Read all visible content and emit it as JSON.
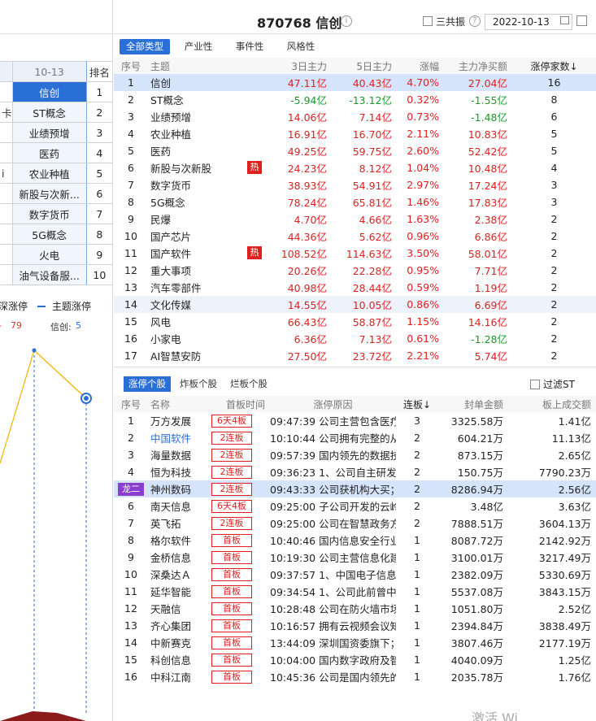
{
  "left": {
    "date_header": "10-13",
    "rank_header": "排名",
    "rows": [
      {
        "topic": "信创",
        "rank": "1",
        "cut": ""
      },
      {
        "topic": "ST概念",
        "rank": "2",
        "cut": "卡"
      },
      {
        "topic": "业绩预增",
        "rank": "3",
        "cut": ""
      },
      {
        "topic": "医药",
        "rank": "4",
        "cut": ""
      },
      {
        "topic": "农业种植",
        "rank": "5",
        "cut": "i"
      },
      {
        "topic": "新股与次新...",
        "rank": "6",
        "cut": ""
      },
      {
        "topic": "数字货币",
        "rank": "7",
        "cut": ""
      },
      {
        "topic": "5G概念",
        "rank": "8",
        "cut": ""
      },
      {
        "topic": "火电",
        "rank": "9",
        "cut": ""
      },
      {
        "topic": "油气设备服...",
        "rank": "10",
        "cut": ""
      }
    ],
    "legend_left": "深涨停",
    "legend_right": "主题涨停",
    "value_a": "-",
    "value_b": "79",
    "label_c": "信创:",
    "value_c": "5"
  },
  "header": {
    "code_title": "870768 信创",
    "checkbox_label": "三共振",
    "date": "2022-10-13"
  },
  "tabs": [
    "全部类型",
    "产业性",
    "事件性",
    "风格性"
  ],
  "topic_table": {
    "columns": [
      "序号",
      "主题",
      "3日主力",
      "5日主力",
      "涨幅",
      "主力净买额",
      "涨停家数↓"
    ],
    "rows": [
      {
        "n": "1",
        "name": "信创",
        "hot": "",
        "d3": "47.11亿",
        "d5": "40.43亿",
        "chg": "4.70%",
        "net": "27.04亿",
        "cnt": "16",
        "c3": "red",
        "c5": "red",
        "cc": "red",
        "cn": "red"
      },
      {
        "n": "2",
        "name": "ST概念",
        "hot": "",
        "d3": "-5.94亿",
        "d5": "-13.12亿",
        "chg": "0.32%",
        "net": "-1.55亿",
        "cnt": "8",
        "c3": "green",
        "c5": "green",
        "cc": "red",
        "cn": "green"
      },
      {
        "n": "3",
        "name": "业绩预增",
        "hot": "",
        "d3": "14.06亿",
        "d5": "7.14亿",
        "chg": "0.73%",
        "net": "-1.48亿",
        "cnt": "6",
        "c3": "red",
        "c5": "red",
        "cc": "red",
        "cn": "green"
      },
      {
        "n": "4",
        "name": "农业种植",
        "hot": "",
        "d3": "16.91亿",
        "d5": "16.70亿",
        "chg": "2.11%",
        "net": "10.83亿",
        "cnt": "5",
        "c3": "red",
        "c5": "red",
        "cc": "red",
        "cn": "red"
      },
      {
        "n": "5",
        "name": "医药",
        "hot": "",
        "d3": "49.25亿",
        "d5": "59.75亿",
        "chg": "2.60%",
        "net": "52.42亿",
        "cnt": "5",
        "c3": "red",
        "c5": "red",
        "cc": "red",
        "cn": "red"
      },
      {
        "n": "6",
        "name": "新股与次新股",
        "hot": "热",
        "d3": "24.23亿",
        "d5": "8.12亿",
        "chg": "1.04%",
        "net": "10.48亿",
        "cnt": "4",
        "c3": "red",
        "c5": "red",
        "cc": "red",
        "cn": "red"
      },
      {
        "n": "7",
        "name": "数字货币",
        "hot": "",
        "d3": "38.93亿",
        "d5": "54.91亿",
        "chg": "2.97%",
        "net": "17.24亿",
        "cnt": "3",
        "c3": "red",
        "c5": "red",
        "cc": "red",
        "cn": "red"
      },
      {
        "n": "8",
        "name": "5G概念",
        "hot": "",
        "d3": "78.24亿",
        "d5": "65.81亿",
        "chg": "1.46%",
        "net": "17.83亿",
        "cnt": "3",
        "c3": "red",
        "c5": "red",
        "cc": "red",
        "cn": "red"
      },
      {
        "n": "9",
        "name": "民爆",
        "hot": "",
        "d3": "4.70亿",
        "d5": "4.66亿",
        "chg": "1.63%",
        "net": "2.38亿",
        "cnt": "2",
        "c3": "red",
        "c5": "red",
        "cc": "red",
        "cn": "red"
      },
      {
        "n": "10",
        "name": "国产芯片",
        "hot": "",
        "d3": "44.36亿",
        "d5": "5.62亿",
        "chg": "0.96%",
        "net": "6.86亿",
        "cnt": "2",
        "c3": "red",
        "c5": "red",
        "cc": "red",
        "cn": "red"
      },
      {
        "n": "11",
        "name": "国产软件",
        "hot": "热",
        "d3": "108.52亿",
        "d5": "114.63亿",
        "chg": "3.50%",
        "net": "58.01亿",
        "cnt": "2",
        "c3": "red",
        "c5": "red",
        "cc": "red",
        "cn": "red"
      },
      {
        "n": "12",
        "name": "重大事项",
        "hot": "",
        "d3": "20.26亿",
        "d5": "22.28亿",
        "chg": "0.95%",
        "net": "7.71亿",
        "cnt": "2",
        "c3": "red",
        "c5": "red",
        "cc": "red",
        "cn": "red"
      },
      {
        "n": "13",
        "name": "汽车零部件",
        "hot": "",
        "d3": "40.98亿",
        "d5": "28.44亿",
        "chg": "0.59%",
        "net": "1.19亿",
        "cnt": "2",
        "c3": "red",
        "c5": "red",
        "cc": "red",
        "cn": "red"
      },
      {
        "n": "14",
        "name": "文化传媒",
        "hot": "",
        "d3": "14.55亿",
        "d5": "10.05亿",
        "chg": "0.86%",
        "net": "6.69亿",
        "cnt": "2",
        "c3": "red",
        "c5": "red",
        "cc": "red",
        "cn": "red"
      },
      {
        "n": "15",
        "name": "风电",
        "hot": "",
        "d3": "66.43亿",
        "d5": "58.87亿",
        "chg": "1.15%",
        "net": "14.16亿",
        "cnt": "2",
        "c3": "red",
        "c5": "red",
        "cc": "red",
        "cn": "red"
      },
      {
        "n": "16",
        "name": "小家电",
        "hot": "",
        "d3": "6.36亿",
        "d5": "7.13亿",
        "chg": "0.61%",
        "net": "-1.28亿",
        "cnt": "2",
        "c3": "red",
        "c5": "red",
        "cc": "red",
        "cn": "green"
      },
      {
        "n": "17",
        "name": "AI智慧安防",
        "hot": "",
        "d3": "27.50亿",
        "d5": "23.72亿",
        "chg": "2.21%",
        "net": "5.74亿",
        "cnt": "2",
        "c3": "red",
        "c5": "red",
        "cc": "red",
        "cn": "red"
      }
    ]
  },
  "stock_tabs": [
    "涨停个股",
    "炸板个股",
    "烂板个股"
  ],
  "filter_label": "过滤ST",
  "stock_table": {
    "columns": [
      "序号",
      "名称",
      "首板时间",
      "涨停原因",
      "连板↓",
      "封单金额",
      "板上成交额"
    ],
    "rows": [
      {
        "n": "1",
        "name": "万方发展",
        "badge": "6天4板",
        "time": "09:47:39",
        "reason": "公司主营包含医疗信...",
        "lb": "3",
        "amt": "3325.58万",
        "vol": "1.41亿"
      },
      {
        "n": "2",
        "name": "中国软件",
        "badge": "2连板",
        "time": "10:10:44",
        "reason": "公司拥有完整的从操...",
        "lb": "2",
        "amt": "604.21万",
        "vol": "11.13亿"
      },
      {
        "n": "3",
        "name": "海量数据",
        "badge": "2连板",
        "time": "09:57:39",
        "reason": "国内领先的数据技术...",
        "lb": "2",
        "amt": "873.15万",
        "vol": "2.65亿"
      },
      {
        "n": "4",
        "name": "恒为科技",
        "badge": "2连板",
        "time": "09:36:23",
        "reason": "1、公司自主研发了...",
        "lb": "2",
        "amt": "150.75万",
        "vol": "7790.23万"
      },
      {
        "n": "龙二",
        "name": "神州数码",
        "badge": "2连板",
        "time": "09:43:33",
        "reason": "公司获机构大买；中...",
        "lb": "2",
        "amt": "8286.94万",
        "vol": "2.56亿"
      },
      {
        "n": "6",
        "name": "南天信息",
        "badge": "6天4板",
        "time": "09:25:00",
        "reason": "子公司开发的云岭先...",
        "lb": "2",
        "amt": "3.48亿",
        "vol": "3.63亿"
      },
      {
        "n": "7",
        "name": "英飞拓",
        "badge": "2连板",
        "time": "09:25:00",
        "reason": "公司在智慧政务方面...",
        "lb": "2",
        "amt": "7888.51万",
        "vol": "3604.13万"
      },
      {
        "n": "8",
        "name": "格尔软件",
        "badge": "首板",
        "time": "10:40:46",
        "reason": "国内信息安全行业PK...",
        "lb": "1",
        "amt": "8087.72万",
        "vol": "2142.92万"
      },
      {
        "n": "9",
        "name": "金桥信息",
        "badge": "首板",
        "time": "10:19:30",
        "reason": "公司主营信息化建设...",
        "lb": "1",
        "amt": "3100.01万",
        "vol": "3217.49万"
      },
      {
        "n": "10",
        "name": "深桑达Ａ",
        "badge": "首板",
        "time": "09:37:57",
        "reason": "1、中国电子信息产...",
        "lb": "1",
        "amt": "2382.09万",
        "vol": "5330.69万"
      },
      {
        "n": "11",
        "name": "延华智能",
        "badge": "首板",
        "time": "09:34:54",
        "reason": "1、公司此前曾中标...",
        "lb": "1",
        "amt": "5537.08万",
        "vol": "3843.15万"
      },
      {
        "n": "12",
        "name": "天融信",
        "badge": "首板",
        "time": "10:28:48",
        "reason": "公司在防火墙市场的...",
        "lb": "1",
        "amt": "1051.80万",
        "vol": "2.52亿"
      },
      {
        "n": "13",
        "name": "齐心集团",
        "badge": "首板",
        "time": "10:16:57",
        "reason": "拥有云视频会议知名...",
        "lb": "1",
        "amt": "2394.84万",
        "vol": "3838.49万"
      },
      {
        "n": "14",
        "name": "中新赛克",
        "badge": "首板",
        "time": "13:44:09",
        "reason": "深圳国资委旗下；公...",
        "lb": "1",
        "amt": "3807.46万",
        "vol": "2177.19万"
      },
      {
        "n": "15",
        "name": "科创信息",
        "badge": "首板",
        "time": "10:04:00",
        "reason": "国内数字政府及智慧...",
        "lb": "1",
        "amt": "4040.09万",
        "vol": "1.25亿"
      },
      {
        "n": "16",
        "name": "中科江南",
        "badge": "首板",
        "time": "10:45:36",
        "reason": "公司是国内领先的智...",
        "lb": "1",
        "amt": "2035.78万",
        "vol": "1.76亿"
      }
    ]
  },
  "watermark": "激活 Wi"
}
